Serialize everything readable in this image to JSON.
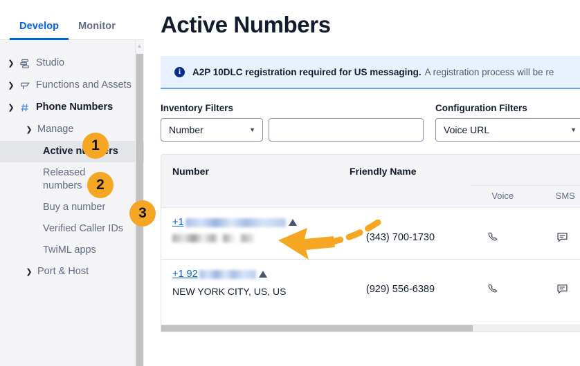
{
  "tabs": [
    {
      "label": "Develop",
      "active": true
    },
    {
      "label": "Monitor",
      "active": false
    }
  ],
  "sidebar": {
    "items": [
      {
        "label": "Studio",
        "icon": "studio-icon",
        "caret": "right",
        "level": 1,
        "bold": false,
        "selected": false
      },
      {
        "label": "Functions and Assets",
        "icon": "functions-icon",
        "caret": "right",
        "level": 1,
        "bold": false,
        "selected": false
      },
      {
        "label": "Phone Numbers",
        "icon": "hash-icon",
        "caret": "down",
        "level": 1,
        "bold": true,
        "selected": false
      },
      {
        "label": "Manage",
        "icon": "",
        "caret": "down",
        "level": 2,
        "bold": false,
        "selected": false
      },
      {
        "label": "Active numbers",
        "icon": "",
        "caret": "",
        "level": 3,
        "bold": true,
        "selected": true
      },
      {
        "label": "Released numbers",
        "icon": "",
        "caret": "",
        "level": 3,
        "bold": false,
        "selected": false
      },
      {
        "label": "Buy a number",
        "icon": "",
        "caret": "",
        "level": 3,
        "bold": false,
        "selected": false
      },
      {
        "label": "Verified Caller IDs",
        "icon": "",
        "caret": "",
        "level": 3,
        "bold": false,
        "selected": false
      },
      {
        "label": "TwiML apps",
        "icon": "",
        "caret": "",
        "level": 3,
        "bold": false,
        "selected": false
      },
      {
        "label": "Port & Host",
        "icon": "",
        "caret": "right",
        "level": 2,
        "bold": false,
        "selected": false
      }
    ]
  },
  "main": {
    "page_title": "Active Numbers",
    "banner": {
      "icon": "info-icon",
      "strong": "A2P 10DLC registration required for US messaging.",
      "text": "A registration process will be re"
    },
    "filters": {
      "inventory_label": "Inventory Filters",
      "inventory_select_value": "Number",
      "inventory_input_value": "",
      "inventory_input_placeholder": "",
      "configuration_label": "Configuration Filters",
      "configuration_select_value": "Voice URL"
    },
    "table": {
      "headers": {
        "number": "Number",
        "friendly_name": "Friendly Name",
        "voice": "Voice",
        "sms": "SMS"
      },
      "rows": [
        {
          "number_prefix": "+1",
          "number_redacted": true,
          "location": "",
          "location_redacted": true,
          "friendly_name": "(343) 700-1730",
          "voice_icon": "phone-icon",
          "sms_icon": "message-icon"
        },
        {
          "number_prefix": "+1 92",
          "number_redacted": true,
          "location": "NEW YORK CITY, US, US",
          "location_redacted": false,
          "friendly_name": "(929) 556-6389",
          "voice_icon": "phone-icon",
          "sms_icon": "message-icon"
        }
      ]
    }
  },
  "annotations": {
    "badges": [
      {
        "number": "1",
        "target": "Phone Numbers"
      },
      {
        "number": "2",
        "target": "Manage"
      },
      {
        "number": "3",
        "target": "Active numbers"
      }
    ],
    "arrow": {
      "color": "#f5a623",
      "style": "dashed",
      "direction": "left",
      "points_to": "first phone number link"
    }
  },
  "colors": {
    "accent": "#0263e0",
    "badge": "#f5a623",
    "sidebar_bg": "#f4f4f6",
    "banner_bg": "#e8f1fd",
    "banner_border": "#66a3ef",
    "text_primary": "#121c2d",
    "text_muted": "#606b85"
  }
}
